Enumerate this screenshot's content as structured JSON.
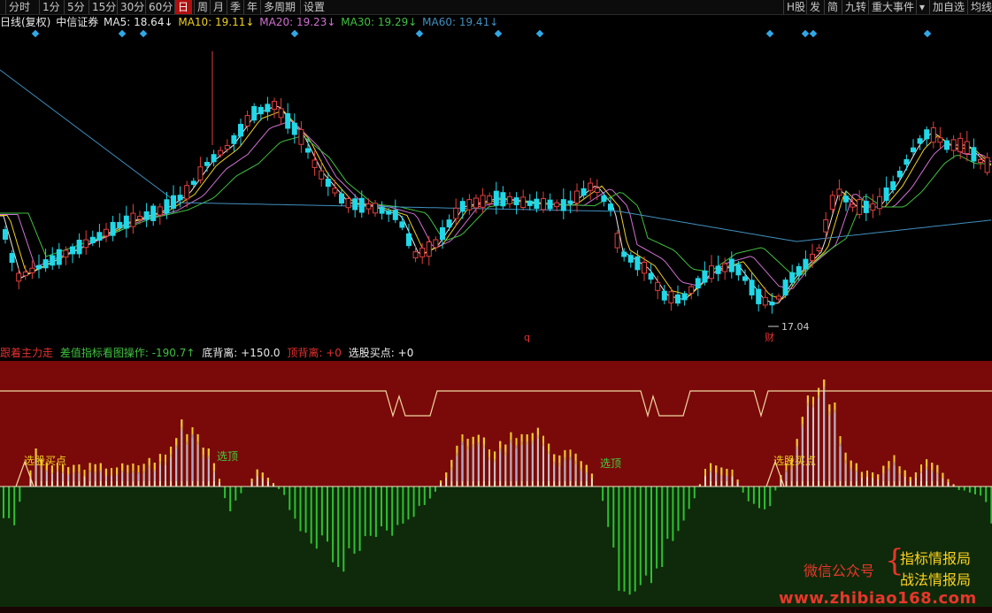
{
  "toolbar": {
    "left_buttons": [
      {
        "label": "分时",
        "active": false
      },
      {
        "label": "1分",
        "active": false
      },
      {
        "label": "5分",
        "active": false
      },
      {
        "label": "15分",
        "active": false
      },
      {
        "label": "30分",
        "active": false
      },
      {
        "label": "60分",
        "active": false
      },
      {
        "label": "日",
        "active": true
      },
      {
        "label": "周",
        "active": false
      },
      {
        "label": "月",
        "active": false
      },
      {
        "label": "季",
        "active": false
      },
      {
        "label": "年",
        "active": false
      },
      {
        "label": "多周期",
        "active": false
      },
      {
        "label": "设置",
        "active": false
      }
    ],
    "right_buttons": [
      {
        "label": "H股"
      },
      {
        "label": "发"
      },
      {
        "label": "简"
      },
      {
        "label": "九转"
      },
      {
        "label": "重大事件"
      },
      {
        "label": "▾"
      },
      {
        "label": "加自选"
      },
      {
        "label": "均线"
      }
    ]
  },
  "main_legend": {
    "period": "日线(复权)",
    "stock": "中信证券",
    "ma": [
      {
        "label": "MA5: 18.64↓",
        "color": "#e8e8e8"
      },
      {
        "label": "MA10: 19.11↓",
        "color": "#f0d020"
      },
      {
        "label": "MA20: 19.23↓",
        "color": "#d070d0"
      },
      {
        "label": "MA30: 19.29↓",
        "color": "#40c040"
      },
      {
        "label": "MA60: 19.41↓",
        "color": "#4090c0"
      }
    ]
  },
  "main_chart": {
    "low_label": "17.04",
    "marker_q": "q",
    "marker_cai": "财"
  },
  "indicator_legend": {
    "name": "跟着主力走",
    "items": [
      {
        "label": "差值指标看图操作: -190.7↑",
        "color": "#40c040"
      },
      {
        "label": "底背离: +150.0",
        "color": "#e8e8e8"
      },
      {
        "label": "顶背离: +0",
        "color": "#e83030"
      },
      {
        "label": "选股买点: +0",
        "color": "#f0f0f0"
      }
    ]
  },
  "indicator_chart": {
    "labels": [
      {
        "text": "选股买点",
        "color": "#f0d020"
      },
      {
        "text": "选顶",
        "color": "#40d040"
      },
      {
        "text": "选顶",
        "color": "#40d040"
      },
      {
        "text": "选股买点",
        "color": "#f0d020"
      }
    ]
  },
  "watermark": {
    "wechat": "微信公众号",
    "line1": "指标情报局",
    "line2": "战法情报局",
    "url": "www.zhibiao168.com"
  },
  "colors": {
    "up": "#e04040",
    "down": "#20d8e8",
    "panel_red": "#7a0a0a",
    "panel_green": "#0e2a0a",
    "bar_pos": "#f0e6c8",
    "bar_pos_top": "#f0c828",
    "bar_neg": "#30c030"
  }
}
